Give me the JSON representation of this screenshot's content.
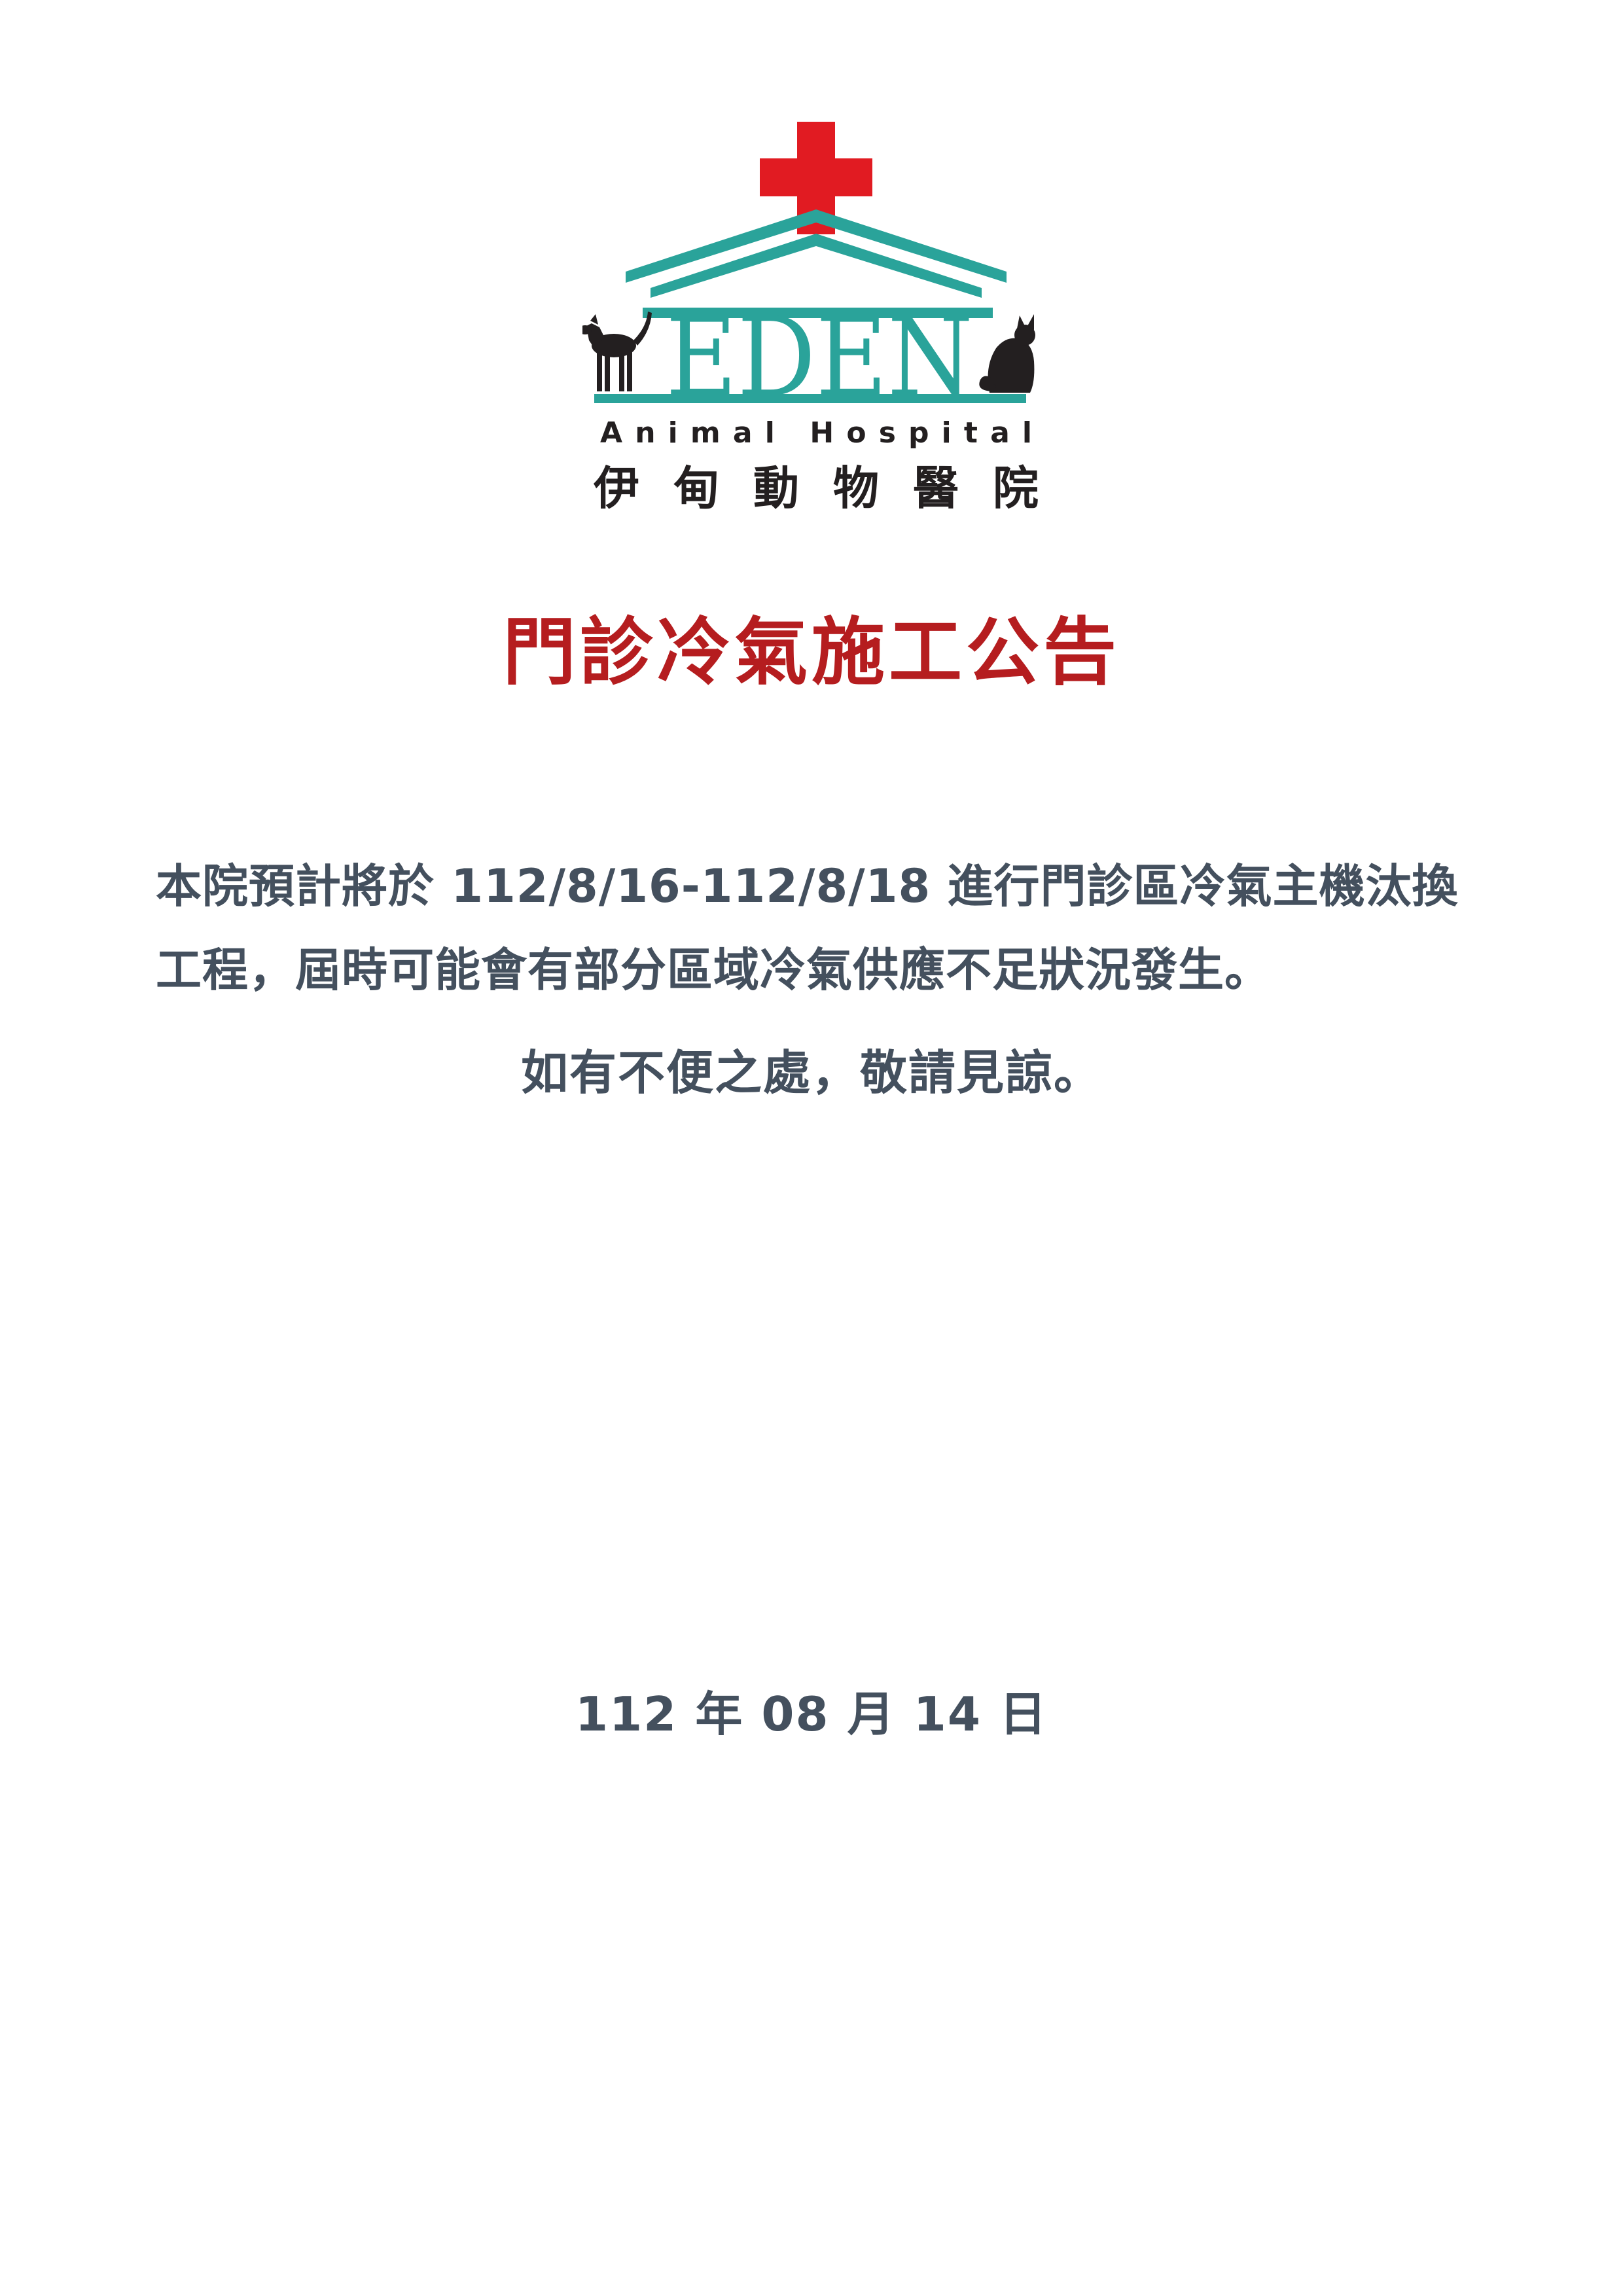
{
  "logo": {
    "brand_text": "EDEN",
    "subtitle_en": "Animal Hospital",
    "subtitle_zh": "伊甸動物醫院",
    "colors": {
      "cross": "#e11b22",
      "teal": "#2aa39a",
      "animal": "#231f20",
      "text": "#231f20"
    }
  },
  "notice": {
    "title": "門診冷氣施工公告",
    "title_color": "#b51d1f",
    "body_lines": [
      "本院預計將於 112/8/16-112/8/18 進行門診區冷氣主機汰換",
      "工程，屆時可能會有部分區域冷氣供應不足狀況發生。"
    ],
    "apology": "如有不便之處，敬請見諒。",
    "date": "112 年 08 月 14 日",
    "text_color": "#44505e"
  }
}
